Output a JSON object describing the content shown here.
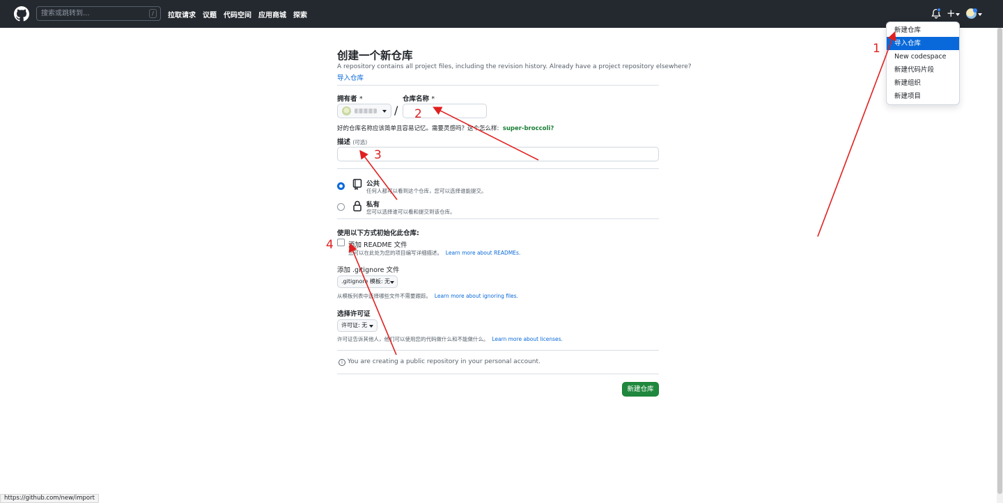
{
  "header": {
    "search_placeholder": "搜索或跳转到...",
    "search_shortcut": "/",
    "nav": [
      "拉取请求",
      "议题",
      "代码空间",
      "应用商城",
      "探索"
    ],
    "plus_symbol": "+"
  },
  "dropdown": {
    "items": [
      "新建仓库",
      "导入仓库",
      "New codespace",
      "新建代码片段",
      "新建组织",
      "新建项目"
    ],
    "active_index": 1
  },
  "form": {
    "title": "创建一个新仓库",
    "subtitle": "A repository contains all project files, including the revision history. Already have a project repository elsewhere?",
    "import_link": "导入仓库",
    "owner_label": "拥有者",
    "repo_label": "仓库名称",
    "required_mark": "*",
    "slash": "/",
    "name_hint": "好的仓库名称应该简单且容易记忆。需要灵感吗？这个怎么样:",
    "name_suggestion": "super-broccoli?",
    "desc_label": "描述",
    "desc_optional": "(可选)",
    "public_title": "公共",
    "public_desc": "任何人都可以看到这个仓库，您可以选择谁能提交。",
    "private_title": "私有",
    "private_desc": "您可以选择谁可以看和提交到该仓库。",
    "init_label": "使用以下方式初始化此仓库:",
    "readme_label": "添加 README 文件",
    "readme_desc": "您可以在此处为您的项目编写详细描述。",
    "readme_link": "Learn more about READMEs.",
    "gitignore_label": "添加 .gitignore 文件",
    "gitignore_select": ".gitignore 模板: 无",
    "gitignore_desc": "从模板列表中选择哪些文件不需要跟踪。",
    "gitignore_link": "Learn more about ignoring files.",
    "license_label": "选择许可证",
    "license_select": "许可证: 无",
    "license_desc": "许可证告诉其他人，他们可以使用您的代码做什么和不能做什么。",
    "license_link": "Learn more about licenses.",
    "info_icon": "i",
    "info_text": "You are creating a public repository in your personal account.",
    "create_button": "新建仓库"
  },
  "annotations": [
    "1",
    "2",
    "3",
    "4"
  ],
  "status_url": "https://github.com/new/import",
  "colors": {
    "header_bg": "#24292f",
    "link": "#0969da",
    "primary_button": "#1f883d",
    "annotation": "#e02020"
  }
}
